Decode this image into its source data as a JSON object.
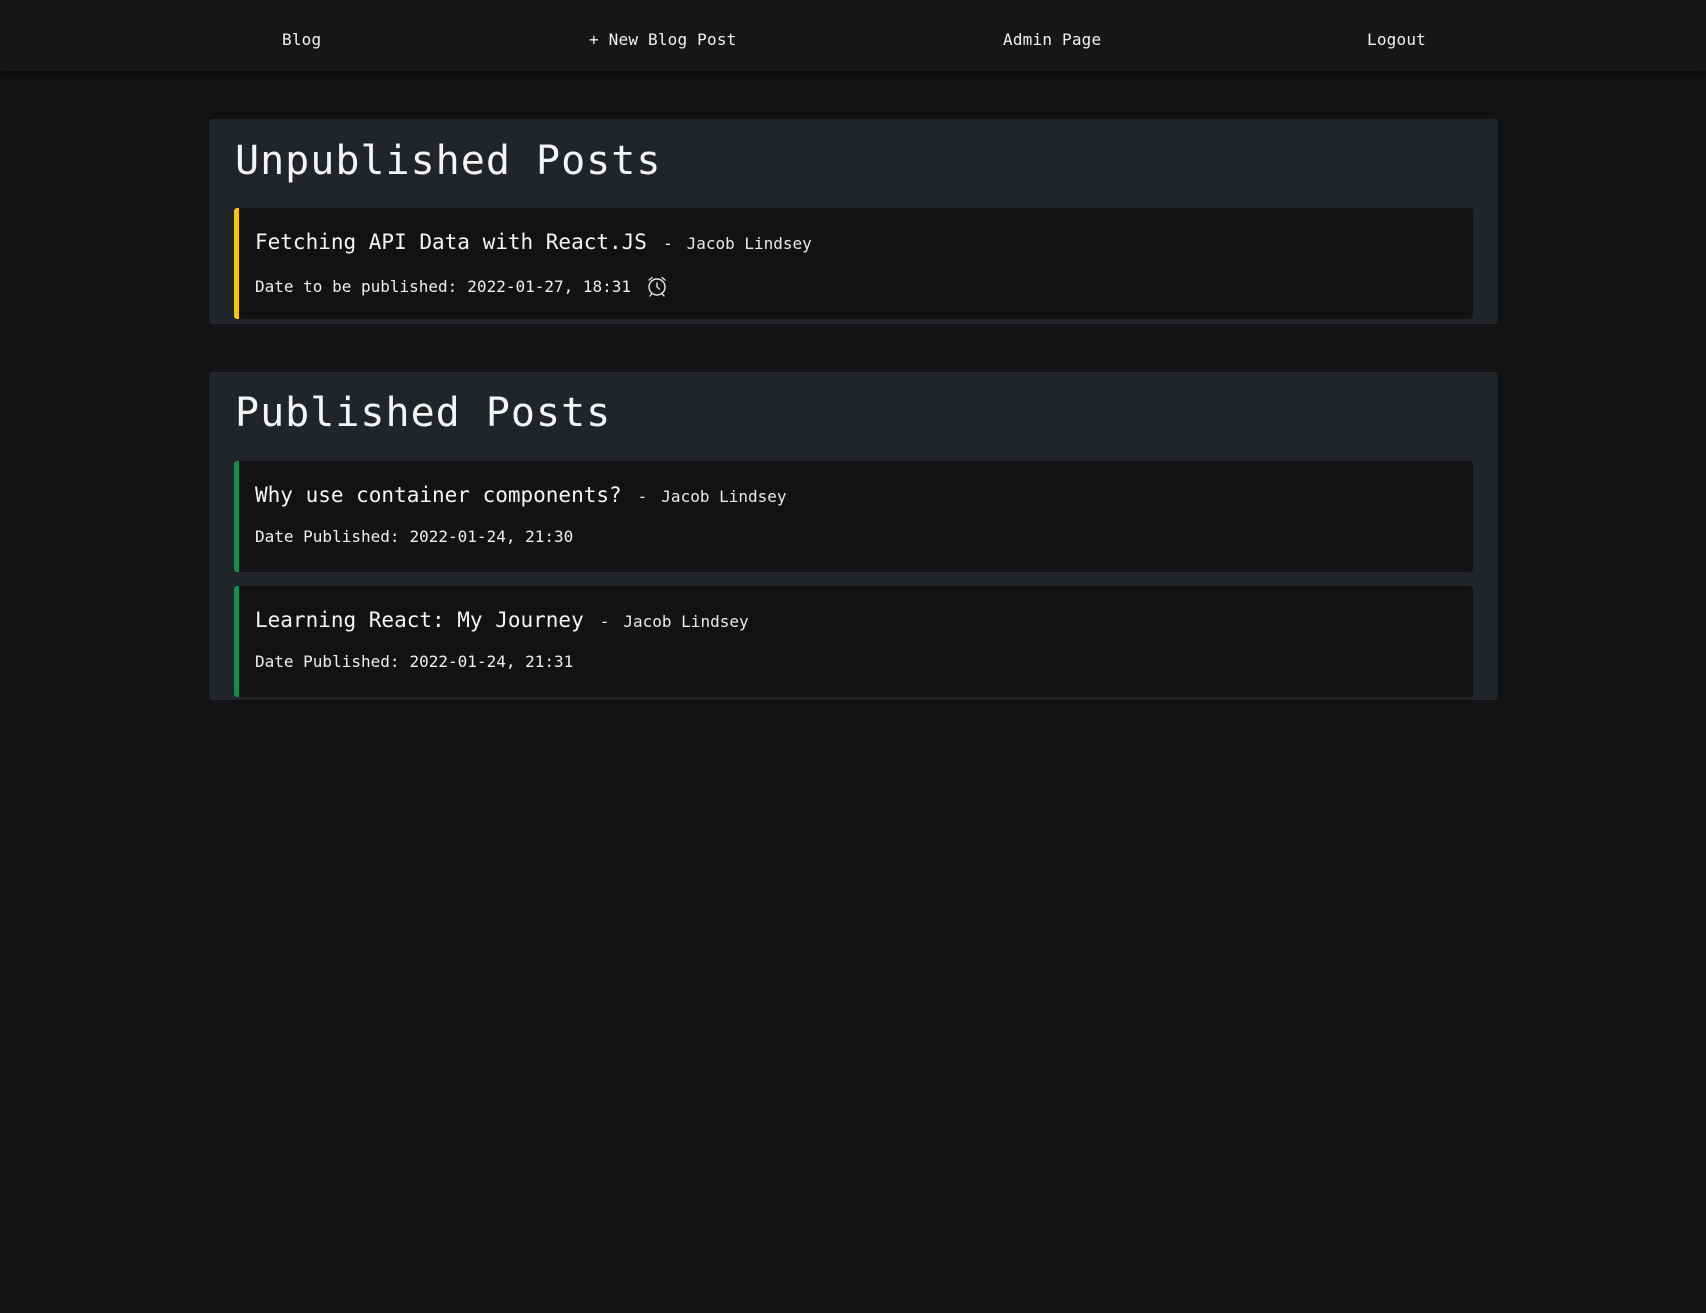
{
  "nav": {
    "blog": "Blog",
    "new_post": "+ New Blog Post",
    "admin": "Admin Page",
    "logout": "Logout"
  },
  "unpublished": {
    "title": "Unpublished Posts",
    "posts": [
      {
        "title": "Fetching API Data with React.JS",
        "separator": "-",
        "author": "Jacob Lindsey",
        "date_label": "Date to be published:",
        "date": "2022-01-27, 18:31",
        "icon": "alarm-clock-icon"
      }
    ]
  },
  "published": {
    "title": "Published Posts",
    "posts": [
      {
        "title": "Why use container components?",
        "separator": "-",
        "author": "Jacob Lindsey",
        "date_label": "Date Published:",
        "date": "2022-01-24, 21:30"
      },
      {
        "title": "Learning React: My Journey",
        "separator": "-",
        "author": "Jacob Lindsey",
        "date_label": "Date Published:",
        "date": "2022-01-24, 21:31"
      }
    ]
  },
  "colors": {
    "background": "#121212",
    "panel": "#212429",
    "pending_accent": "#f5c21b",
    "published_accent": "#1c8a4c"
  }
}
